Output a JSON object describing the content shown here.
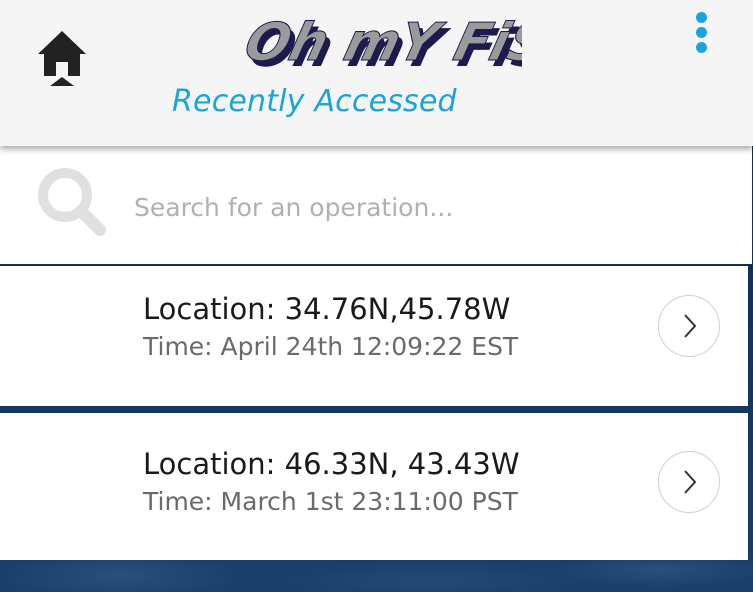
{
  "app": {
    "logo_text": "Oh mY FiSH!",
    "subtitle": "Recently Accessed"
  },
  "header": {
    "home_icon": "home-icon",
    "menu_icon": "more-vertical-icon"
  },
  "search": {
    "placeholder": "Search for an operation...",
    "value": "",
    "icon": "search-icon"
  },
  "operations": [
    {
      "location": "Location: 34.76N,45.78W",
      "time": "Time: April 24th 12:09:22 EST",
      "action_icon": "chevron-right-icon"
    },
    {
      "location": "Location: 46.33N, 43.43W",
      "time": "Time: March 1st 23:11:00 PST",
      "action_icon": "chevron-right-icon"
    }
  ],
  "colors": {
    "accent": "#1ba3dc",
    "logo_fill": "#9a9a9a",
    "logo_shadow": "#1c1a4e",
    "header_bg": "#f5f5f5",
    "background": "#12325a"
  }
}
